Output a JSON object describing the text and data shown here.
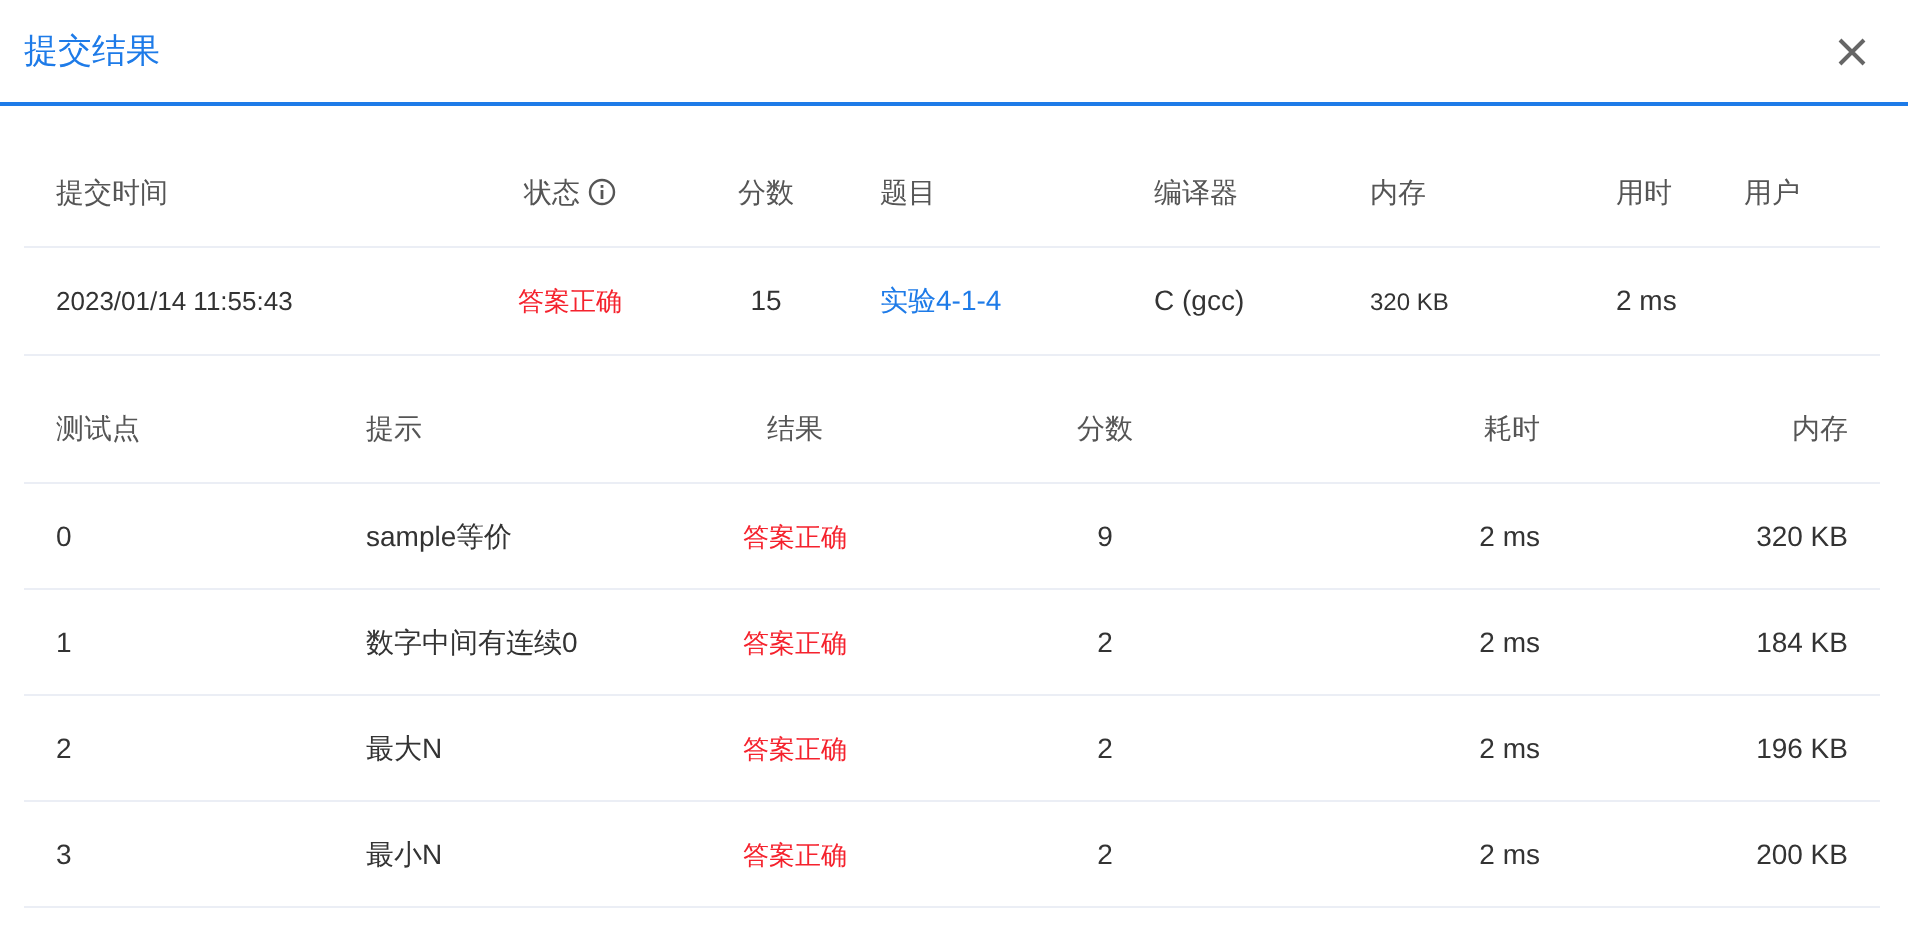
{
  "dialog": {
    "title": "提交结果"
  },
  "submission": {
    "columns": [
      "提交时间",
      "状态",
      "分数",
      "题目",
      "编译器",
      "内存",
      "用时",
      "用户"
    ],
    "row": {
      "time": "2023/01/14 11:55:43",
      "status": {
        "text": "答案正确",
        "kind": "accepted"
      },
      "score": "15",
      "problem": "实验4-1-4",
      "compiler": "C (gcc)",
      "memory": "320 KB",
      "duration": "2 ms"
    }
  },
  "tests": {
    "columns": [
      "测试点",
      "提示",
      "结果",
      "分数",
      "耗时",
      "内存"
    ],
    "rows": [
      {
        "case": "0",
        "hint": "sample等价",
        "result": {
          "text": "答案正确",
          "kind": "accepted"
        },
        "score": "9",
        "duration": "2 ms",
        "memory": "320 KB"
      },
      {
        "case": "1",
        "hint": "数字中间有连续0",
        "result": {
          "text": "答案正确",
          "kind": "accepted"
        },
        "score": "2",
        "duration": "2 ms",
        "memory": "184 KB"
      },
      {
        "case": "2",
        "hint": "最大N",
        "result": {
          "text": "答案正确",
          "kind": "accepted"
        },
        "score": "2",
        "duration": "2 ms",
        "memory": "196 KB"
      },
      {
        "case": "3",
        "hint": "最小N",
        "result": {
          "text": "答案正确",
          "kind": "accepted"
        },
        "score": "2",
        "duration": "2 ms",
        "memory": "200 KB"
      }
    ]
  }
}
